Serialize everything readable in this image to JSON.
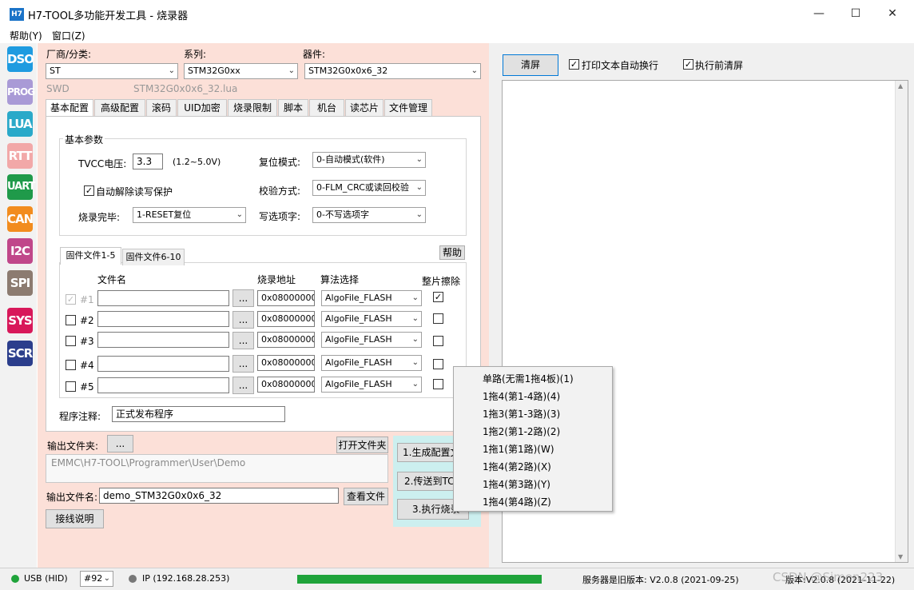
{
  "window": {
    "app_icon": "H7",
    "title": "H7-TOOL多功能开发工具 - 烧录器",
    "minimize": "—",
    "maximize": "☐",
    "close": "✕"
  },
  "menu": {
    "help": "帮助(Y)",
    "window": "窗口(Z)"
  },
  "toolbar": [
    {
      "label": "DSO",
      "color": "#1e9be0"
    },
    {
      "label": "PROG",
      "color": "#a99ad6"
    },
    {
      "label": "LUA",
      "color": "#2aa9c9"
    },
    {
      "label": "RTT",
      "color": "#f2a8a8"
    },
    {
      "label": "UART",
      "color": "#1f9a4a"
    },
    {
      "label": "CAN",
      "color": "#f28c1e"
    },
    {
      "label": "I2C",
      "color": "#c0478a"
    },
    {
      "label": "SPI",
      "color": "#8c7b70"
    },
    {
      "label": "SYS",
      "color": "#d8185a"
    },
    {
      "label": "SCR",
      "color": "#2b3e8c"
    }
  ],
  "device": {
    "vendor_label": "厂商/分类:",
    "vendor_value": "ST",
    "series_label": "系列:",
    "series_value": "STM32G0xx",
    "device_label": "器件:",
    "device_value": "STM32G0x0x6_32",
    "interface": "SWD",
    "lua_file": "STM32G0x0x6_32.lua"
  },
  "tabs": [
    "基本配置",
    "高级配置",
    "滚码",
    "UID加密",
    "烧录限制",
    "脚本",
    "机台",
    "读芯片",
    "文件管理"
  ],
  "basic": {
    "group_title": "基本参数",
    "tvcc_label": "TVCC电压:",
    "tvcc_value": "3.3",
    "tvcc_range": "(1.2~5.0V)",
    "auto_unprotect_label": "自动解除读写保护",
    "reset_mode_label": "复位模式:",
    "reset_mode_value": "0-自动模式(软件)",
    "verify_label": "校验方式:",
    "verify_value": "0-FLM_CRC或读回校验",
    "finish_label": "烧录完毕:",
    "finish_value": "1-RESET复位",
    "option_label": "写选项字:",
    "option_value": "0-不写选项字"
  },
  "firmware": {
    "tab1": "固件文件1-5",
    "tab2": "固件文件6-10",
    "help_button": "帮助",
    "col_filename": "文件名",
    "col_address": "烧录地址",
    "col_algo": "算法选择",
    "col_erase": "整片擦除",
    "browse": "...",
    "rows": [
      {
        "num": "#1",
        "address": "0x08000000",
        "algo": "AlgoFile_FLASH",
        "checked": "✓",
        "erase": "✓"
      },
      {
        "num": "#2",
        "address": "0x08000000",
        "algo": "AlgoFile_FLASH",
        "checked": "",
        "erase": ""
      },
      {
        "num": "#3",
        "address": "0x08000000",
        "algo": "AlgoFile_FLASH",
        "checked": "",
        "erase": ""
      },
      {
        "num": "#4",
        "address": "0x08000000",
        "algo": "AlgoFile_FLASH",
        "checked": "",
        "erase": ""
      },
      {
        "num": "#5",
        "address": "0x08000000",
        "algo": "AlgoFile_FLASH",
        "checked": "",
        "erase": ""
      }
    ],
    "comment_label": "程序注释:",
    "comment_value": "正式发布程序"
  },
  "output": {
    "folder_label": "输出文件夹:",
    "folder_browse": "...",
    "open_folder": "打开文件夹",
    "folder_path": "EMMC\\H7-TOOL\\Programmer\\User\\Demo",
    "filename_label": "输出文件名:",
    "filename_value": "demo_STM32G0x0x6_32",
    "view_file": "查看文件",
    "wiring": "接线说明",
    "step1": "1.生成配置文",
    "step2": "2.传送到TC",
    "step3": "3.执行烧录"
  },
  "right": {
    "clear": "清屏",
    "wrap_label": "打印文本自动换行",
    "clear_before_label": "执行前清屏"
  },
  "popup_menu": [
    "单路(无需1拖4板)(1)",
    "1拖4(第1-4路)(4)",
    "1拖3(第1-3路)(3)",
    "1拖2(第1-2路)(2)",
    "1拖1(第1路)(W)",
    "1拖4(第2路)(X)",
    "1拖4(第3路)(Y)",
    "1拖4(第4路)(Z)"
  ],
  "status": {
    "usb": "USB (HID)",
    "device_num": "#92",
    "ip": "IP (192.168.28.253)",
    "progress": 1.0,
    "server": "服务器是旧版本: V2.0.8 (2021-09-25)",
    "version": "版本:V2.0.8 (2021-11-22)",
    "watermark": "CSDN @Simon223"
  },
  "colors": {
    "left_bg": "#fce0d8",
    "progress": "#1fa33a",
    "accent": "#0078d7"
  }
}
